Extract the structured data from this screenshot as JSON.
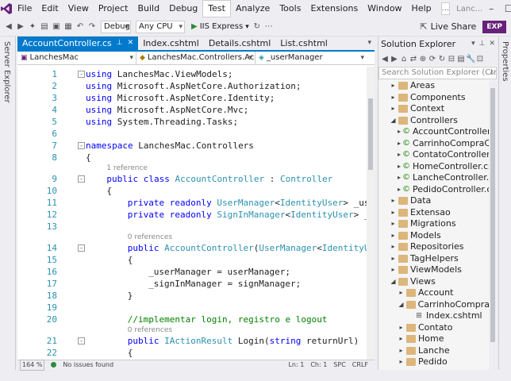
{
  "menu": {
    "items": [
      "File",
      "Edit",
      "View",
      "Project",
      "Build",
      "Debug",
      "Test",
      "Analyze",
      "Tools",
      "Extensions",
      "Window",
      "Help"
    ],
    "search_text": "...",
    "solution_name": "Lanc..."
  },
  "toolbar": {
    "config": "Debug",
    "platform": "Any CPU",
    "run_label": "IIS Express",
    "live_share": "Live Share",
    "badge": "EXP"
  },
  "rails": {
    "left": "Server Explorer",
    "right": "Properties"
  },
  "editor": {
    "tabs": [
      {
        "label": "AccountController.cs",
        "active": true
      },
      {
        "label": "Index.cshtml",
        "active": false
      },
      {
        "label": "Details.cshtml",
        "active": false
      },
      {
        "label": "List.cshtml",
        "active": false
      }
    ],
    "nav": [
      "LanchesMac",
      "LanchesMac.Controllers.Acco",
      "_userManager"
    ],
    "status": {
      "zoom": "164 %",
      "issues": "No issues found",
      "line": "Ln: 1",
      "col": "Ch: 1",
      "spc": "SPC",
      "crlf": "CRLF"
    }
  },
  "code": {
    "lines": [
      {
        "n": "1",
        "fold": "-",
        "indent": 0,
        "tokens": [
          [
            "kw",
            "using"
          ],
          [
            "",
            "LanchesMac.ViewModels;"
          ]
        ]
      },
      {
        "n": "2",
        "fold": "",
        "indent": 0,
        "tokens": [
          [
            "kw",
            "using"
          ],
          [
            "",
            "Microsoft.AspNetCore.Authorization;"
          ]
        ]
      },
      {
        "n": "3",
        "fold": "",
        "indent": 0,
        "tokens": [
          [
            "kw",
            "using"
          ],
          [
            "",
            "Microsoft.AspNetCore.Identity;"
          ]
        ]
      },
      {
        "n": "4",
        "fold": "",
        "indent": 0,
        "tokens": [
          [
            "kw",
            "using"
          ],
          [
            "",
            "Microsoft.AspNetCore.Mvc;"
          ]
        ]
      },
      {
        "n": "5",
        "fold": "",
        "indent": 0,
        "tokens": [
          [
            "kw",
            "using"
          ],
          [
            "",
            "System.Threading.Tasks;"
          ]
        ]
      },
      {
        "n": "6",
        "fold": "",
        "indent": 0,
        "tokens": []
      },
      {
        "n": "7",
        "fold": "-",
        "indent": 0,
        "tokens": [
          [
            "kw",
            "namespace"
          ],
          [
            "",
            "LanchesMac.Controllers"
          ]
        ]
      },
      {
        "n": "8",
        "fold": "",
        "indent": 0,
        "tokens": [
          [
            "",
            "{"
          ]
        ]
      },
      {
        "n": "9",
        "fold": "-",
        "indent": 1,
        "ref": "1 reference",
        "tokens": [
          [
            "kw",
            "public"
          ],
          [
            "kw",
            "class"
          ],
          [
            "ty",
            "AccountController"
          ],
          [
            "",
            ":"
          ],
          [
            "ty",
            "Controller"
          ]
        ]
      },
      {
        "n": "10",
        "fold": "",
        "indent": 1,
        "tokens": [
          [
            "",
            "{"
          ]
        ]
      },
      {
        "n": "11",
        "fold": "",
        "indent": 2,
        "tokens": [
          [
            "kw",
            "private"
          ],
          [
            "kw",
            "readonly"
          ],
          [
            "ty",
            "UserManager"
          ],
          [
            "",
            "<"
          ],
          [
            "ty",
            "IdentityUser"
          ],
          [
            "",
            "> _userM"
          ]
        ]
      },
      {
        "n": "12",
        "fold": "",
        "indent": 2,
        "tokens": [
          [
            "kw",
            "private"
          ],
          [
            "kw",
            "readonly"
          ],
          [
            "ty",
            "SignInManager"
          ],
          [
            "",
            "<"
          ],
          [
            "ty",
            "IdentityUser"
          ],
          [
            "",
            "> _sig"
          ]
        ]
      },
      {
        "n": "13",
        "fold": "",
        "indent": 0,
        "tokens": []
      },
      {
        "n": "14",
        "fold": "-",
        "indent": 2,
        "ref": "0 references",
        "tokens": [
          [
            "kw",
            "public"
          ],
          [
            "ty",
            "AccountController"
          ],
          [
            "",
            "("
          ],
          [
            "ty",
            "UserManager"
          ],
          [
            "",
            "<"
          ],
          [
            "ty",
            "IdentityUse"
          ]
        ]
      },
      {
        "n": "15",
        "fold": "",
        "indent": 2,
        "tokens": [
          [
            "",
            "{"
          ]
        ]
      },
      {
        "n": "16",
        "fold": "",
        "indent": 3,
        "tokens": [
          [
            "",
            "_userManager = userManager;"
          ]
        ]
      },
      {
        "n": "17",
        "fold": "",
        "indent": 3,
        "tokens": [
          [
            "",
            "_signInManager = signManager;"
          ]
        ]
      },
      {
        "n": "18",
        "fold": "",
        "indent": 2,
        "tokens": [
          [
            "",
            "}"
          ]
        ]
      },
      {
        "n": "19",
        "fold": "",
        "indent": 0,
        "tokens": []
      },
      {
        "n": "20",
        "fold": "",
        "indent": 2,
        "tokens": [
          [
            "cm",
            "//implementar login, registro e logout"
          ]
        ]
      },
      {
        "n": "21",
        "fold": "-",
        "indent": 2,
        "ref": "0 references",
        "tokens": [
          [
            "kw",
            "public"
          ],
          [
            "ty",
            "IActionResult"
          ],
          [
            "",
            "Login("
          ],
          [
            "kw",
            "string"
          ],
          [
            "",
            "returnUrl)"
          ]
        ]
      },
      {
        "n": "22",
        "fold": "",
        "indent": 2,
        "tokens": [
          [
            "",
            "{"
          ]
        ]
      },
      {
        "n": "23",
        "fold": "",
        "indent": 3,
        "tokens": [
          [
            "kw",
            "return"
          ],
          [
            "",
            "View("
          ],
          [
            "kw",
            "new"
          ],
          [
            "ty",
            "LoginViewModel"
          ],
          [
            "",
            "()"
          ]
        ]
      }
    ]
  },
  "solution_explorer": {
    "title": "Solution Explorer",
    "search_placeholder": "Search Solution Explorer (Ctrl+;)",
    "items": [
      {
        "label": "Areas",
        "level": 0,
        "arrow": "▸",
        "type": "folder"
      },
      {
        "label": "Components",
        "level": 0,
        "arrow": "▸",
        "type": "folder"
      },
      {
        "label": "Context",
        "level": 0,
        "arrow": "▸",
        "type": "folder"
      },
      {
        "label": "Controllers",
        "level": 0,
        "arrow": "◢",
        "type": "folder"
      },
      {
        "label": "AccountController.c",
        "level": 1,
        "arrow": "▸",
        "type": "cs"
      },
      {
        "label": "CarrinhoCompraCor",
        "level": 1,
        "arrow": "▸",
        "type": "cs"
      },
      {
        "label": "ContatoController.c",
        "level": 1,
        "arrow": "▸",
        "type": "cs"
      },
      {
        "label": "HomeController.cs",
        "level": 1,
        "arrow": "▸",
        "type": "cs"
      },
      {
        "label": "LancheController.cs",
        "level": 1,
        "arrow": "▸",
        "type": "cs"
      },
      {
        "label": "PedidoController.cs",
        "level": 1,
        "arrow": "▸",
        "type": "cs"
      },
      {
        "label": "Data",
        "level": 0,
        "arrow": "▸",
        "type": "folder"
      },
      {
        "label": "Extensao",
        "level": 0,
        "arrow": "▸",
        "type": "folder"
      },
      {
        "label": "Migrations",
        "level": 0,
        "arrow": "▸",
        "type": "folder"
      },
      {
        "label": "Models",
        "level": 0,
        "arrow": "▸",
        "type": "folder"
      },
      {
        "label": "Repositories",
        "level": 0,
        "arrow": "▸",
        "type": "folder"
      },
      {
        "label": "TagHelpers",
        "level": 0,
        "arrow": "▸",
        "type": "folder"
      },
      {
        "label": "ViewModels",
        "level": 0,
        "arrow": "▸",
        "type": "folder"
      },
      {
        "label": "Views",
        "level": 0,
        "arrow": "◢",
        "type": "folder"
      },
      {
        "label": "Account",
        "level": 1,
        "arrow": "▸",
        "type": "folder"
      },
      {
        "label": "CarrinhoCompra",
        "level": 1,
        "arrow": "◢",
        "type": "folder"
      },
      {
        "label": "Index.cshtml",
        "level": 2,
        "arrow": "",
        "type": "html"
      },
      {
        "label": "Contato",
        "level": 1,
        "arrow": "▸",
        "type": "folder"
      },
      {
        "label": "Home",
        "level": 1,
        "arrow": "▸",
        "type": "folder"
      },
      {
        "label": "Lanche",
        "level": 1,
        "arrow": "▸",
        "type": "folder"
      },
      {
        "label": "Pedido",
        "level": 1,
        "arrow": "▸",
        "type": "folder"
      }
    ]
  },
  "colors": {
    "accent": "#007acc",
    "badge": "#68217a",
    "keyword": "#0000ff",
    "type": "#2b91af",
    "comment": "#008000"
  }
}
